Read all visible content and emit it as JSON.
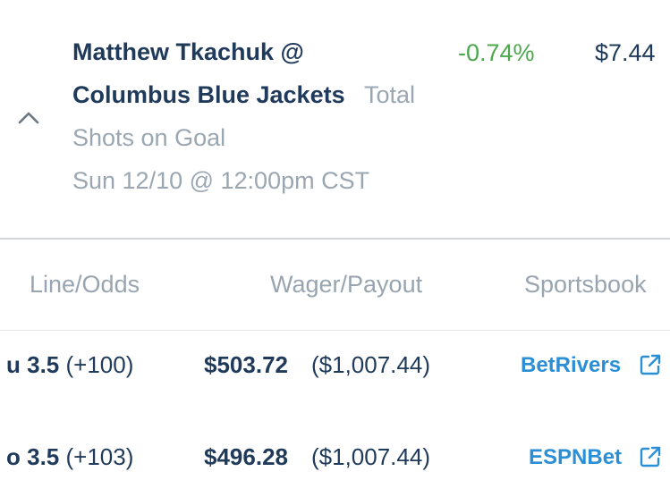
{
  "bet": {
    "title_line1": "Matthew Tkachuk @",
    "title_line2": "Columbus Blue Jackets",
    "type_label": "Total",
    "market": "Shots on Goal",
    "datetime": "Sun 12/10 @ 12:00pm CST",
    "edge_pct": "-0.74%",
    "price": "$7.44"
  },
  "columns": {
    "line_odds": "Line/Odds",
    "wager_payout": "Wager/Payout",
    "sportsbook": "Sportsbook"
  },
  "rows": [
    {
      "line": "u 3.5",
      "odds": "(+100)",
      "wager": "$503.72",
      "payout": "($1,007.44)",
      "book": "BetRivers"
    },
    {
      "line": "o 3.5",
      "odds": "(+103)",
      "wager": "$496.28",
      "payout": "($1,007.44)",
      "book": "ESPNBet"
    }
  ],
  "colors": {
    "navy": "#1f3a5a",
    "green": "#4ca84c",
    "link_blue": "#2b8fd6",
    "muted": "#9aa7b3"
  },
  "icons": [
    "chevron-up-icon",
    "external-link-icon"
  ]
}
